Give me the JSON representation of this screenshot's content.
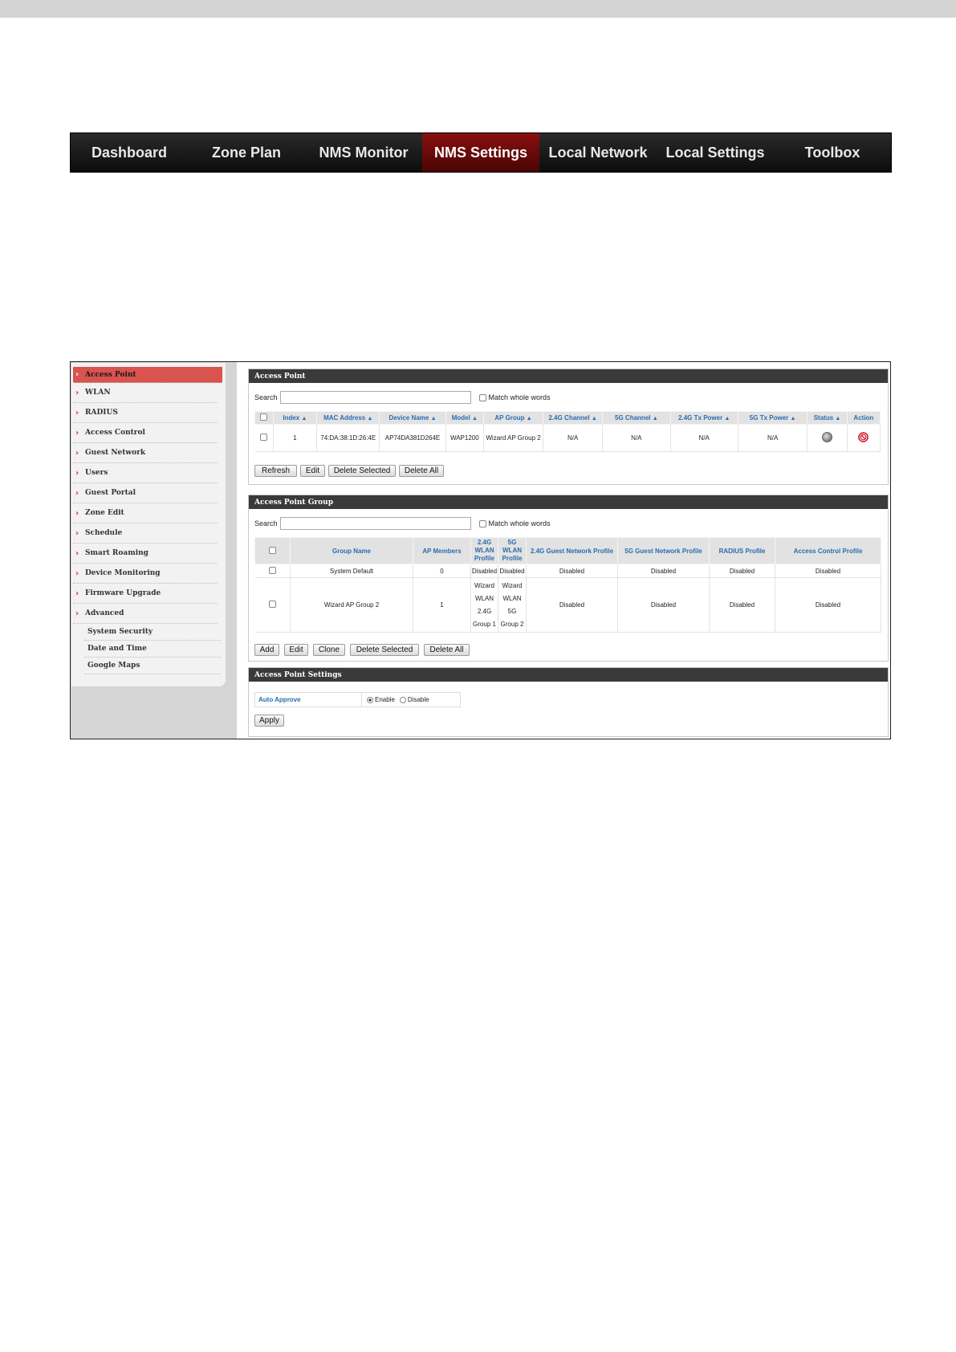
{
  "nav": {
    "items": [
      {
        "label": "Dashboard"
      },
      {
        "label": "Zone Plan"
      },
      {
        "label": "NMS Monitor"
      },
      {
        "label": "NMS Settings",
        "active": true
      },
      {
        "label": "Local Network"
      },
      {
        "label": "Local Settings"
      },
      {
        "label": "Toolbox"
      }
    ]
  },
  "sidebar": {
    "items": [
      {
        "label": "Access Point",
        "active": true
      },
      {
        "label": "WLAN"
      },
      {
        "label": "RADIUS"
      },
      {
        "label": "Access Control"
      },
      {
        "label": "Guest Network"
      },
      {
        "label": "Users"
      },
      {
        "label": "Guest Portal"
      },
      {
        "label": "Zone Edit"
      },
      {
        "label": "Schedule"
      },
      {
        "label": "Smart Roaming"
      },
      {
        "label": "Device Monitoring"
      },
      {
        "label": "Firmware Upgrade"
      },
      {
        "label": "Advanced"
      }
    ],
    "subitems": [
      {
        "label": "System Security"
      },
      {
        "label": "Date and Time"
      },
      {
        "label": "Google Maps"
      }
    ]
  },
  "access_point": {
    "title": "Access Point",
    "search_label": "Search",
    "search_value": "",
    "match_label": "Match whole words",
    "columns": [
      "Index",
      "MAC Address",
      "Device Name",
      "Model",
      "AP Group",
      "2.4G Channel",
      "5G Channel",
      "2.4G Tx Power",
      "5G Tx Power",
      "Status",
      "Action"
    ],
    "rows": [
      {
        "index": "1",
        "mac": "74:DA:38:1D:26:4E",
        "device_name": "AP74DA381D264E",
        "model": "WAP1200",
        "ap_group": "Wizard AP Group 2",
        "ch24": "N/A",
        "ch5": "N/A",
        "tx24": "N/A",
        "tx5": "N/A",
        "status_icon": "status-gray-icon",
        "action_icon": "block-icon"
      }
    ],
    "buttons": {
      "refresh": "Refresh",
      "edit": "Edit",
      "delete_selected": "Delete Selected",
      "delete_all": "Delete All"
    }
  },
  "ap_group": {
    "title": "Access Point Group",
    "search_label": "Search",
    "search_value": "",
    "match_label": "Match whole words",
    "columns": {
      "group_name": "Group Name",
      "ap_members": "AP Members",
      "wlan24": "2.4G WLAN Profile",
      "wlan5": "5G WLAN Profile",
      "guest24": "2.4G Guest Network Profile",
      "guest5": "5G Guest Network Profile",
      "radius": "RADIUS Profile",
      "acl": "Access Control Profile"
    },
    "rows": [
      {
        "group_name": "System Default",
        "ap_members": "0",
        "wlan24": "Disabled",
        "wlan5": "Disabled",
        "guest24": "Disabled",
        "guest5": "Disabled",
        "radius": "Disabled",
        "acl": "Disabled"
      },
      {
        "group_name": "Wizard AP Group 2",
        "ap_members": "1",
        "wlan24": "Wizard WLAN 2.4G Group 1",
        "wlan5": "Wizard WLAN 5G Group 2",
        "guest24": "Disabled",
        "guest5": "Disabled",
        "radius": "Disabled",
        "acl": "Disabled"
      }
    ],
    "buttons": {
      "add": "Add",
      "edit": "Edit",
      "clone": "Clone",
      "delete_selected": "Delete Selected",
      "delete_all": "Delete All"
    }
  },
  "ap_settings": {
    "title": "Access Point Settings",
    "auto_approve_label": "Auto Approve",
    "enable_label": "Enable",
    "disable_label": "Disable",
    "selected": "Enable",
    "apply_label": "Apply"
  }
}
